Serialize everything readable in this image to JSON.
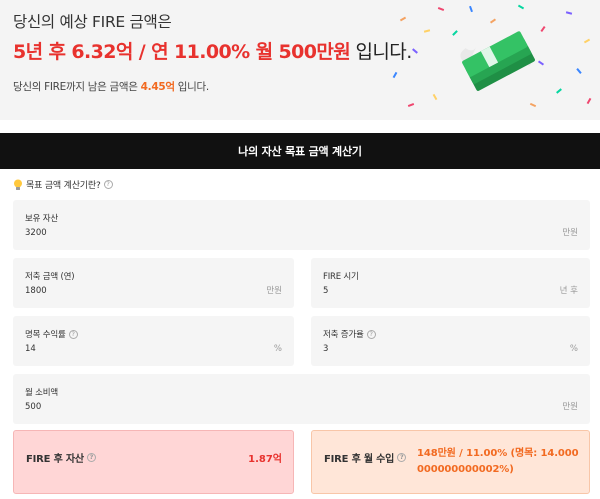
{
  "hero": {
    "line1": "당신의 예상 FIRE 금액은",
    "line2_highlight": "5년 후 6.32억 / 연 11.00% 월 500만원",
    "line2_suffix": " 입니다.",
    "line3_prefix": "당신의 FIRE까지 남은 금액은 ",
    "line3_highlight": "4.45억",
    "line3_suffix": " 입니다."
  },
  "banner": {
    "title": "나의 자산 목표 금액 계산기"
  },
  "hint": {
    "text": "목표 금액 계산기란?"
  },
  "fields": {
    "assets": {
      "label": "보유 자산",
      "value": "3200",
      "unit": "만원"
    },
    "savings": {
      "label": "저축 금액 (연)",
      "value": "1800",
      "unit": "만원"
    },
    "fire_time": {
      "label": "FIRE 시기",
      "value": "5",
      "unit": "년 후"
    },
    "nominal_return": {
      "label": "명목 수익률",
      "value": "14",
      "unit": "%"
    },
    "savings_growth": {
      "label": "저축 증가율",
      "value": "3",
      "unit": "%"
    },
    "monthly_spend": {
      "label": "월 소비액",
      "value": "500",
      "unit": "만원"
    }
  },
  "results": {
    "assets_after": {
      "label": "FIRE 후 자산",
      "value": "1.87억"
    },
    "monthly_income": {
      "label": "FIRE 후 월 수입",
      "value": "148만원 / 11.00% (명목: 14.000000000000002%)"
    }
  },
  "colors": {
    "accent_red": "#e8322e",
    "accent_orange": "#f26a21",
    "banner_bg": "#111111"
  },
  "icons": [
    "lightbulb-icon",
    "help-icon",
    "money-stack-illustration",
    "confetti-decoration"
  ]
}
